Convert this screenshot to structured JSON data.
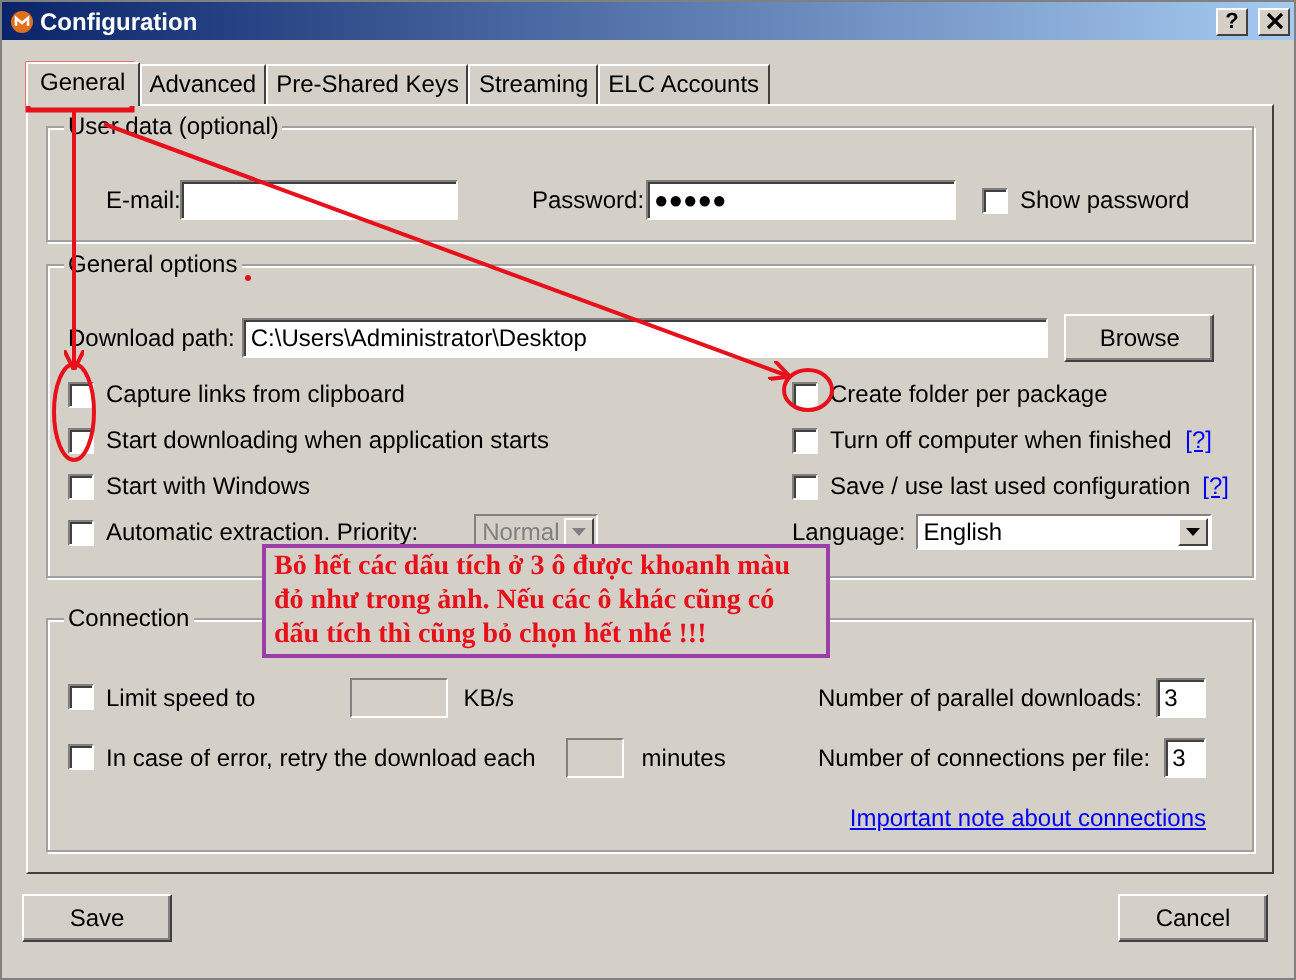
{
  "window": {
    "title": "Configuration",
    "help": "?"
  },
  "tabs": [
    {
      "label": "General",
      "selected": true
    },
    {
      "label": "Advanced",
      "selected": false
    },
    {
      "label": "Pre-Shared Keys",
      "selected": false
    },
    {
      "label": "Streaming",
      "selected": false
    },
    {
      "label": "ELC Accounts",
      "selected": false
    }
  ],
  "user_data": {
    "legend": "User data (optional)",
    "email": {
      "label": "E-mail:"
    },
    "password": {
      "label": "Password:",
      "value": "●●●●●"
    },
    "show_password": {
      "label": "Show password",
      "checked": false
    }
  },
  "general_options": {
    "legend": "General options",
    "download_path": {
      "label": "Download path:",
      "value": "C:\\Users\\Administrator\\Desktop"
    },
    "browse": "Browse",
    "left": [
      {
        "label": "Capture links from clipboard",
        "checked": false
      },
      {
        "label": "Start downloading when application starts",
        "checked": false
      },
      {
        "label": "Start with Windows",
        "checked": false
      },
      {
        "label": "Automatic extraction. Priority:",
        "checked": false,
        "select": {
          "value": "Normal",
          "disabled": true
        }
      }
    ],
    "right": [
      {
        "kind": "checkbox",
        "label": "Create folder per package",
        "checked": false
      },
      {
        "kind": "checkbox",
        "label": "Turn off computer when finished",
        "checked": false,
        "help_link": "[?]"
      },
      {
        "kind": "checkbox",
        "label": "Save / use last used configuration",
        "checked": false,
        "help_link": "[?]"
      },
      {
        "kind": "select",
        "label": "Language:",
        "value": "English",
        "disabled": false
      }
    ]
  },
  "connection": {
    "legend": "Connection",
    "limit_speed": {
      "label": "Limit speed to",
      "checked": false,
      "unit": "KB/s"
    },
    "retry": {
      "label": "In case of error, retry the download each",
      "checked": false,
      "unit": "minutes"
    },
    "parallel_downloads": {
      "label": "Number of parallel downloads:",
      "value": "3"
    },
    "connections_per_file": {
      "label": "Number of connections per file:",
      "value": "3"
    },
    "link": "Important note about connections"
  },
  "buttons": {
    "save": "Save",
    "cancel": "Cancel"
  },
  "annotation": {
    "note": "Bỏ hết các dấu tích ở 3 ô được khoanh màu đỏ như trong ảnh. Nếu các ô khác cũng có dấu tích thì cũng bỏ chọn hết nhé !!!"
  }
}
